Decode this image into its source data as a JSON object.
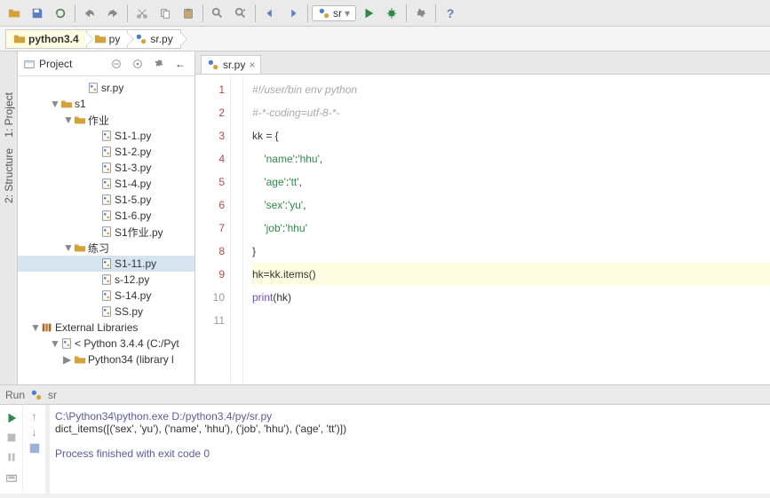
{
  "toolbar": {
    "run_config": "sr"
  },
  "breadcrumbs": [
    "python3.4",
    "py",
    "sr.py"
  ],
  "project_panel": {
    "title": "Project"
  },
  "sidebar_tabs": [
    "1: Project",
    "2: Structure"
  ],
  "tree": [
    {
      "indent": 60,
      "icon": "py",
      "label": "sr.py"
    },
    {
      "indent": 30,
      "arrow": "▼",
      "icon": "folder",
      "label": "s1"
    },
    {
      "indent": 45,
      "arrow": "▼",
      "icon": "folder",
      "label": "作业"
    },
    {
      "indent": 75,
      "icon": "py",
      "label": "S1-1.py"
    },
    {
      "indent": 75,
      "icon": "py",
      "label": "S1-2.py"
    },
    {
      "indent": 75,
      "icon": "py",
      "label": "S1-3.py"
    },
    {
      "indent": 75,
      "icon": "py",
      "label": "S1-4.py"
    },
    {
      "indent": 75,
      "icon": "py",
      "label": "S1-5.py"
    },
    {
      "indent": 75,
      "icon": "py",
      "label": "S1-6.py"
    },
    {
      "indent": 75,
      "icon": "py",
      "label": "S1作业.py"
    },
    {
      "indent": 45,
      "arrow": "▼",
      "icon": "folder",
      "label": "练习"
    },
    {
      "indent": 75,
      "icon": "py",
      "label": "S1-11.py",
      "sel": true
    },
    {
      "indent": 75,
      "icon": "py",
      "label": "s-12.py"
    },
    {
      "indent": 75,
      "icon": "py",
      "label": "S-14.py"
    },
    {
      "indent": 75,
      "icon": "py",
      "label": "SS.py"
    },
    {
      "indent": 8,
      "arrow": "▼",
      "icon": "lib",
      "label": "External Libraries"
    },
    {
      "indent": 30,
      "arrow": "▼",
      "icon": "py",
      "label": "< Python 3.4.4 (C:/Pyt"
    },
    {
      "indent": 45,
      "arrow": "▶",
      "icon": "folder",
      "label": "Python34 (library l"
    }
  ],
  "editor": {
    "tab_name": "sr.py",
    "lines": [
      {
        "n": 1,
        "red": true,
        "html": "<span class='cm'>#!/user/bin env python</span>"
      },
      {
        "n": 2,
        "red": true,
        "html": "<span class='cm'>#-*-coding=utf-8-*-</span>"
      },
      {
        "n": 3,
        "red": true,
        "html": "kk = {"
      },
      {
        "n": 4,
        "red": true,
        "html": "    <span class='str'>'name'</span>:<span class='str'>'hhu'</span>,"
      },
      {
        "n": 5,
        "red": true,
        "html": "    <span class='str'>'age'</span>:<span class='str'>'tt'</span>,"
      },
      {
        "n": 6,
        "red": true,
        "html": "    <span class='str'>'sex'</span>:<span class='str'>'yu'</span>,"
      },
      {
        "n": 7,
        "red": true,
        "html": "    <span class='str'>'job'</span>:<span class='str'>'hhu'</span>"
      },
      {
        "n": 8,
        "red": true,
        "html": "}"
      },
      {
        "n": 9,
        "red": true,
        "html": "hk=kk.items()",
        "hl": true
      },
      {
        "n": 10,
        "red": false,
        "html": "<span class='fn'>print</span>(hk)"
      },
      {
        "n": 11,
        "red": false,
        "html": ""
      }
    ]
  },
  "run_panel": {
    "title": "Run",
    "config": "sr",
    "lines": [
      {
        "cls": "out",
        "text": "C:\\Python34\\python.exe D:/python3.4/py/sr.py"
      },
      {
        "cls": "",
        "text": "dict_items([('sex', 'yu'), ('name', 'hhu'), ('job', 'hhu'), ('age', 'tt')])"
      },
      {
        "cls": "",
        "text": ""
      },
      {
        "cls": "out",
        "text": "Process finished with exit code 0"
      }
    ]
  }
}
